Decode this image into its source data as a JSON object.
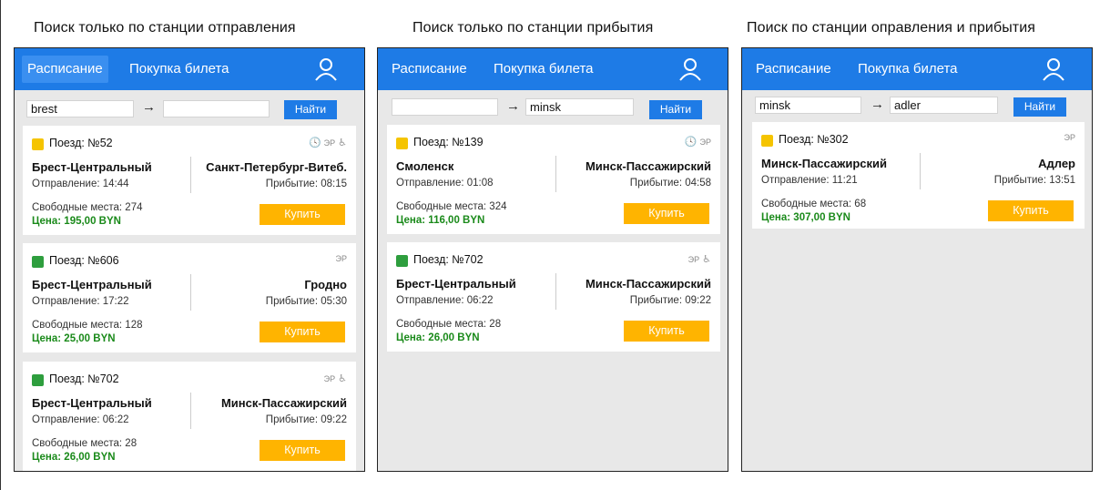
{
  "columns": [
    {
      "title": "Поиск только по станции отправления",
      "nav": [
        "Расписание",
        "Покупка билета"
      ],
      "search": {
        "from": "brest",
        "to": "",
        "arrow": "→",
        "button": "Найти"
      },
      "cards": [
        {
          "train": "Поезд: №52",
          "badge_color": "#f5c400",
          "amenities": [
            "clock-icon",
            "wheelchair-icon"
          ],
          "amenity_text": "ЭР",
          "from": "Брест-Центральный",
          "to": "Санкт-Петербург-Витеб.",
          "depart": "Отправление: 14:44",
          "arrive": "Прибытие: 08:15",
          "seats": "Свободные места: 274",
          "price": "Цена: 195,00 BYN",
          "buy": "Купить"
        },
        {
          "train": "Поезд: №606",
          "badge_color": "#2e9e3e",
          "amenities": [],
          "amenity_text": "ЭР",
          "from": "Брест-Центральный",
          "to": "Гродно",
          "depart": "Отправление: 17:22",
          "arrive": "Прибытие: 05:30",
          "seats": "Свободные места: 128",
          "price": "Цена: 25,00 BYN",
          "buy": "Купить"
        },
        {
          "train": "Поезд: №702",
          "badge_color": "#2e9e3e",
          "amenities": [
            "wheelchair-icon"
          ],
          "amenity_text": "ЭР",
          "from": "Брест-Центральный",
          "to": "Минск-Пассажирский",
          "depart": "Отправление: 06:22",
          "arrive": "Прибытие: 09:22",
          "seats": "Свободные места: 28",
          "price": "Цена: 26,00 BYN",
          "buy": "Купить"
        }
      ]
    },
    {
      "title": "Поиск только по станции прибытия",
      "nav": [
        "Расписание",
        "Покупка билета"
      ],
      "search": {
        "from": "",
        "to": "minsk",
        "arrow": "→",
        "button": "Найти"
      },
      "cards": [
        {
          "train": "Поезд: №139",
          "badge_color": "#f5c400",
          "amenities": [
            "clock-icon"
          ],
          "amenity_text": "ЭР",
          "from": "Смоленск",
          "to": "Минск-Пассажирский",
          "depart": "Отправление: 01:08",
          "arrive": "Прибытие: 04:58",
          "seats": "Свободные места: 324",
          "price": "Цена: 116,00 BYN",
          "buy": "Купить"
        },
        {
          "train": "Поезд: №702",
          "badge_color": "#2e9e3e",
          "amenities": [
            "wheelchair-icon"
          ],
          "amenity_text": "ЭР",
          "from": "Брест-Центральный",
          "to": "Минск-Пассажирский",
          "depart": "Отправление: 06:22",
          "arrive": "Прибытие: 09:22",
          "seats": "Свободные места: 28",
          "price": "Цена: 26,00 BYN",
          "buy": "Купить"
        }
      ]
    },
    {
      "title": "Поиск по станции оправления и прибытия",
      "nav": [
        "Расписание",
        "Покупка билета"
      ],
      "search": {
        "from": "minsk",
        "to": "adler",
        "arrow": "→",
        "button": "Найти"
      },
      "cards": [
        {
          "train": "Поезд: №302",
          "badge_color": "#f5c400",
          "amenities": [],
          "amenity_text": "ЭР",
          "from": "Минск-Пассажирский",
          "to": "Адлер",
          "depart": "Отправление: 11:21",
          "arrive": "Прибытие: 13:51",
          "seats": "Свободные места: 68",
          "price": "Цена: 307,00 BYN",
          "buy": "Купить"
        }
      ]
    }
  ],
  "colors": {
    "appbar": "#1e7be6",
    "buy": "#ffb400",
    "price": "#1a8a1a",
    "background": "#e8e8e8"
  }
}
